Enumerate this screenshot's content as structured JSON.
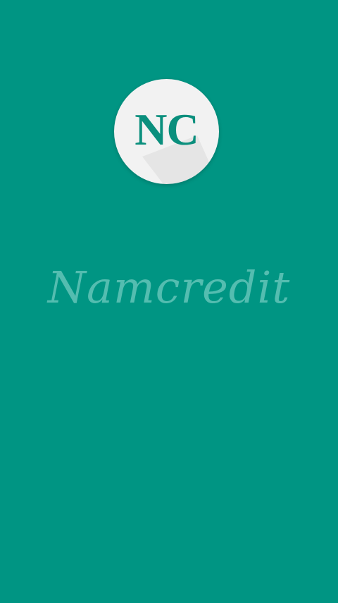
{
  "splash": {
    "logo_text": "NC",
    "brand_name": "Namcredit"
  },
  "colors": {
    "background": "#009583",
    "logo_circle": "#f2f2f2",
    "logo_text": "#0a8f7d",
    "brand_text": "#54bdb0"
  }
}
